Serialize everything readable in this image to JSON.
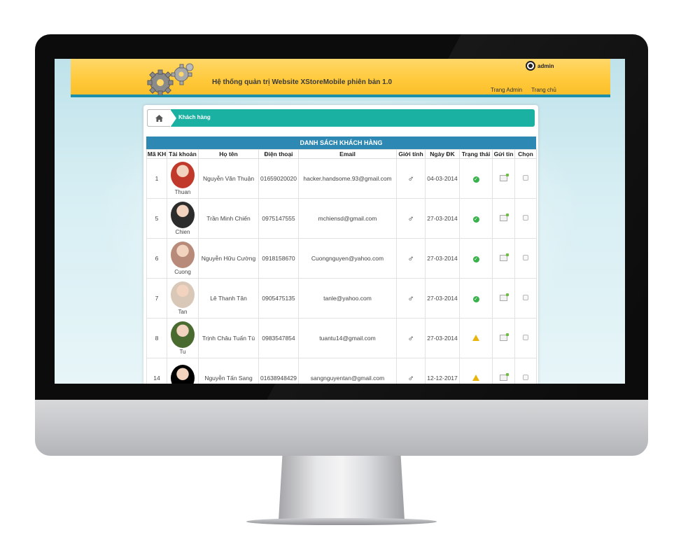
{
  "header": {
    "site_title": "Hệ thống quản trị Website XStoreMobile phiên bản 1.0",
    "admin_name": "admin",
    "links": [
      "Trang Admin",
      "Trang chủ"
    ]
  },
  "breadcrumb": {
    "current": "Khách hàng"
  },
  "table": {
    "caption": "DANH SÁCH KHÁCH HÀNG",
    "columns": [
      "Mã KH",
      "Tài khoản",
      "Họ tên",
      "Điện thoại",
      "Email",
      "Giới tính",
      "Ngày ĐK",
      "Trạng thái",
      "Gửi tin",
      "Chọn"
    ],
    "rows": [
      {
        "id": "1",
        "account": "Thuan",
        "name": "Nguyễn Văn Thuận",
        "phone": "01659020020",
        "email": "hacker.handsome.93@gmail.com",
        "gender_icon": "male-icon",
        "reg_date": "04-03-2014",
        "status": "ok",
        "avatar_color": "#c0392b"
      },
      {
        "id": "5",
        "account": "Chien",
        "name": "Trần Minh Chiến",
        "phone": "0975147555",
        "email": "mchiensd@gmail.com",
        "gender_icon": "male-icon",
        "reg_date": "27-03-2014",
        "status": "ok",
        "avatar_color": "#2c2c2c"
      },
      {
        "id": "6",
        "account": "Cuong",
        "name": "Nguyễn Hữu Cường",
        "phone": "0918158670",
        "email": "Cuongnguyen@yahoo.com",
        "gender_icon": "male-icon",
        "reg_date": "27-03-2014",
        "status": "ok",
        "avatar_color": "#b88a7a"
      },
      {
        "id": "7",
        "account": "Tan",
        "name": "Lê Thanh Tân",
        "phone": "0905475135",
        "email": "tanle@yahoo.com",
        "gender_icon": "male-icon",
        "reg_date": "27-03-2014",
        "status": "ok",
        "avatar_color": "#d9c7b8"
      },
      {
        "id": "8",
        "account": "Tu",
        "name": "Trịnh Châu Tuấn Tú",
        "phone": "0983547854",
        "email": "tuantu14@gmail.com",
        "gender_icon": "male-icon",
        "reg_date": "27-03-2014",
        "status": "warning",
        "avatar_color": "#4a6b2f"
      },
      {
        "id": "14",
        "account": "",
        "name": "Nguyễn Tấn Sang",
        "phone": "01638948429",
        "email": "sangnguyentan@gmail.com",
        "gender_icon": "male-icon",
        "reg_date": "12-12-2017",
        "status": "warning",
        "avatar_color": "#000000"
      }
    ]
  },
  "colors": {
    "header_bg": "#ffc93a",
    "accent_teal": "#1bb1a2",
    "caption_blue": "#2e88b4",
    "link_blue": "#3a8fd0"
  }
}
